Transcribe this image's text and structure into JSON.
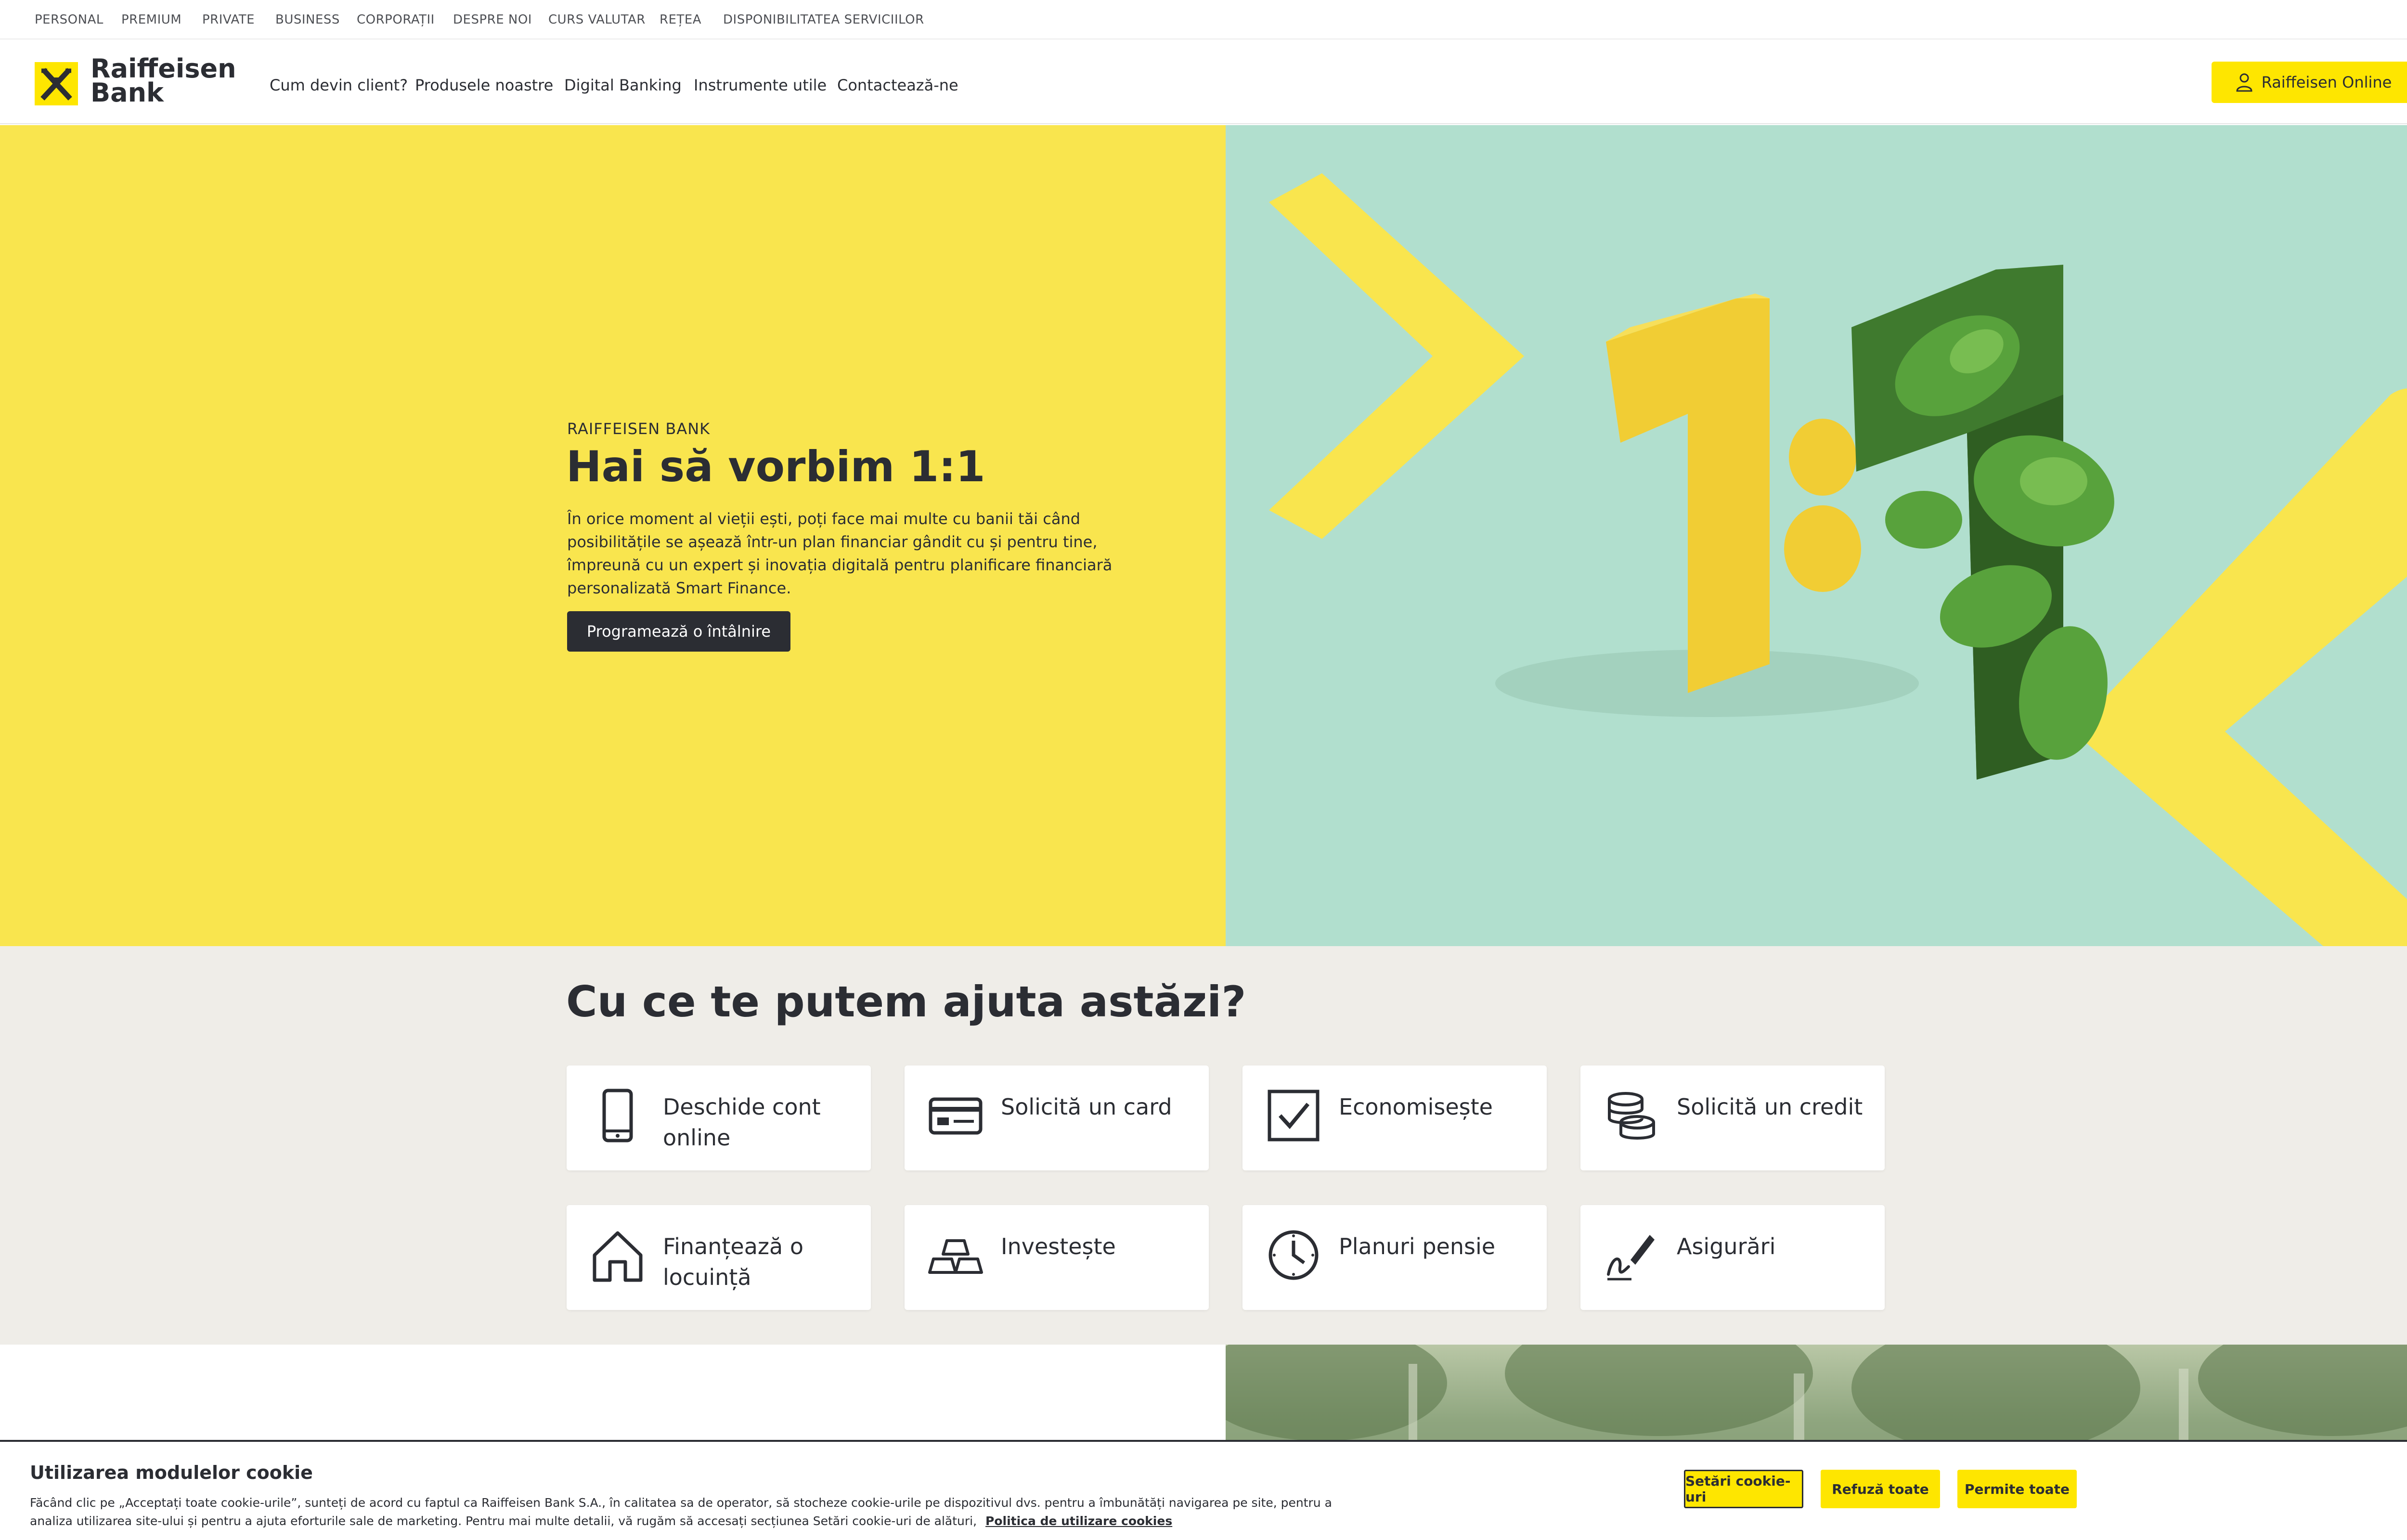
{
  "top_nav": {
    "items": [
      "PERSONAL",
      "PREMIUM",
      "PRIVATE",
      "BUSINESS",
      "CORPORAȚII",
      "DESPRE NOI",
      "CURS VALUTAR",
      "REȚEA",
      "DISPONIBILITATEA SERVICIILOR"
    ]
  },
  "header": {
    "logo_line1": "Raiffeisen",
    "logo_line2": "Bank",
    "nav": [
      "Cum devin client?",
      "Produsele noastre",
      "Digital Banking",
      "Instrumente utile",
      "Contactează-ne"
    ],
    "login_label": "Raiffeisen Online"
  },
  "hero": {
    "eyebrow": "RAIFFEISEN BANK",
    "title": "Hai să vorbim 1:1",
    "description": "În orice moment al vieții ești, poți face mai multe cu banii tăi când posibilitățile se așează într-un plan financiar gândit cu și pentru tine, împreună cu un expert și inovația digitală pentru planificare financiară personalizată Smart Finance.",
    "cta_label": "Programează o întâlnire"
  },
  "help": {
    "title": "Cu ce te putem ajuta astăzi?",
    "tiles": [
      {
        "label": "Deschide cont online",
        "icon": "phone-icon"
      },
      {
        "label": "Solicită un card",
        "icon": "card-icon"
      },
      {
        "label": "Economisește",
        "icon": "checkbox-icon"
      },
      {
        "label": "Solicită un credit",
        "icon": "coins-icon"
      },
      {
        "label": "Finanțează o locuință",
        "icon": "house-icon"
      },
      {
        "label": "Investește",
        "icon": "gold-bars-icon"
      },
      {
        "label": "Planuri pensie",
        "icon": "clock-icon"
      },
      {
        "label": "Asigurări",
        "icon": "signature-icon"
      }
    ]
  },
  "cookie": {
    "title": "Utilizarea modulelor cookie",
    "text": "Făcând clic pe „Acceptați toate cookie-urile”, sunteți de acord cu faptul ca Raiffeisen Bank S.A., în calitatea sa de operator, să stocheze cookie-urile pe dispozitivul dvs. pentru a îmbunătăți navigarea pe site, pentru a analiza utilizarea site-ului și pentru a ajuta eforturile sale de marketing. Pentru mai multe detalii, vă rugăm să accesați secțiunea Setări cookie-uri de alături,",
    "link": "Politica de utilizare cookies",
    "buttons": [
      "Setări cookie-uri",
      "Refuză toate",
      "Permite toate"
    ]
  },
  "colors": {
    "brand_yellow": "#fee600",
    "hero_yellow": "#f9e54e",
    "hero_mint": "#b1dfce",
    "section_beige": "#efede8",
    "text_dark": "#2b2d33"
  }
}
